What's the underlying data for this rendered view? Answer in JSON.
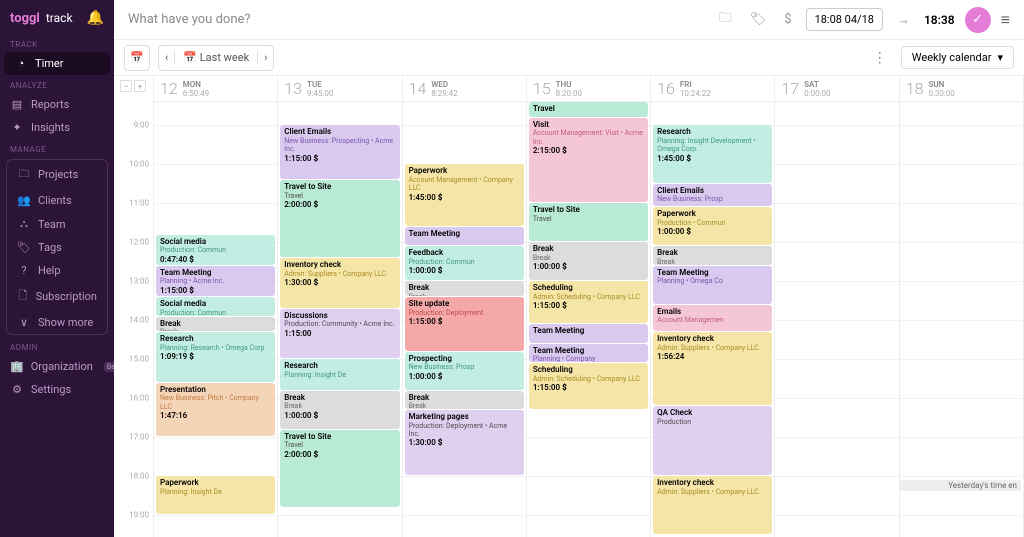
{
  "brand": {
    "name": "toggl",
    "sub": "track"
  },
  "sidebar": {
    "sections": [
      {
        "header": "TRACK",
        "items": [
          {
            "icon": "◔",
            "label": "Timer",
            "active": true
          }
        ]
      },
      {
        "header": "ANALYZE",
        "items": [
          {
            "icon": "▤",
            "label": "Reports"
          },
          {
            "icon": "✦",
            "label": "Insights"
          }
        ]
      },
      {
        "header": "MANAGE",
        "group": true,
        "items": [
          {
            "icon": "🗀",
            "label": "Projects"
          },
          {
            "icon": "👥",
            "label": "Clients"
          },
          {
            "icon": "⛬",
            "label": "Team"
          },
          {
            "icon": "🏷",
            "label": "Tags"
          },
          {
            "icon": "?",
            "label": "Help"
          },
          {
            "icon": "🗋",
            "label": "Subscription"
          },
          {
            "icon": "∨",
            "label": "Show more"
          }
        ]
      },
      {
        "header": "ADMIN",
        "items": [
          {
            "icon": "🏢",
            "label": "Organization",
            "beta": "Beta"
          },
          {
            "icon": "⚙",
            "label": "Settings"
          }
        ]
      }
    ]
  },
  "topbar": {
    "hint": "What have you done?",
    "timebox": "18:08  04/18",
    "arrow": "→",
    "time": "18:38"
  },
  "toolbar": {
    "lastweek": "Last week",
    "view": "Weekly calendar"
  },
  "hours": [
    "9:00",
    "10:00",
    "11:00",
    "12:00",
    "13:00",
    "14:00",
    "15:00",
    "16:00",
    "17:00",
    "18:00",
    "19:00"
  ],
  "sliceH": 39,
  "headerH": 26,
  "startHour": 8.4,
  "days": [
    {
      "num": "12",
      "wd": "MON",
      "total": "6:50:49"
    },
    {
      "num": "13",
      "wd": "TUE",
      "total": "9:45:00"
    },
    {
      "num": "14",
      "wd": "WED",
      "total": "8:29:42"
    },
    {
      "num": "15",
      "wd": "THU",
      "total": "8:20:00"
    },
    {
      "num": "16",
      "wd": "FRI",
      "total": "10:24:22"
    },
    {
      "num": "17",
      "wd": "SAT",
      "total": "0:00:00"
    },
    {
      "num": "18",
      "wd": "SUN",
      "total": "0:30:00"
    }
  ],
  "past_note": "Yesterday's time en",
  "colors": {
    "teal": "#c2ede2",
    "tealT": "#2a8a6e",
    "purple": "#d9c9ee",
    "purpleT": "#6b3fa0",
    "yellow": "#f5e6a8",
    "yellowT": "#9a7d0a",
    "pink": "#f5c6d6",
    "pinkT": "#b84a6e",
    "orange": "#f5d5b8",
    "orangeT": "#b86a2a",
    "gray": "#dcdcdc",
    "grayT": "#555",
    "red": "#f5a8a8",
    "redT": "#b83a3a",
    "mint": "#b8ead6",
    "blue": "#cfe0f0",
    "blueT": "#3a6ab8",
    "lav": "#e0d0f0"
  },
  "events": {
    "0": [
      {
        "s": 11.8,
        "e": 12.6,
        "c": "teal",
        "t": "Social media",
        "p": "Production: Commun",
        "d": "0:47:40",
        "bill": true
      },
      {
        "s": 12.6,
        "e": 13.4,
        "c": "purple",
        "t": "Team Meeting",
        "p": "Planning • Acme Inc.",
        "d": "1:15:00",
        "bill": true
      },
      {
        "s": 13.4,
        "e": 13.9,
        "c": "teal",
        "t": "Social media",
        "p": "Production: Commun"
      },
      {
        "s": 13.9,
        "e": 14.3,
        "c": "gray",
        "t": "Break",
        "p": "Break"
      },
      {
        "s": 14.3,
        "e": 15.6,
        "c": "teal",
        "t": "Research",
        "p": "Planning: Research • Omega Corp",
        "d": "1:09:19",
        "bill": true
      },
      {
        "s": 15.6,
        "e": 17.0,
        "c": "orange",
        "t": "Presentation",
        "p": "New Business: Pitch • Company LLC",
        "d": "1:47:16"
      },
      {
        "s": 18.0,
        "e": 19.0,
        "c": "yellow",
        "t": "Paperwork",
        "p": "Planning: Insight De"
      }
    ],
    "1": [
      {
        "s": 9.0,
        "e": 10.4,
        "c": "purple",
        "t": "Client Emails",
        "p": "New Business: Prospecting • Acme Inc.",
        "d": "1:15:00",
        "bill": true
      },
      {
        "s": 10.4,
        "e": 12.4,
        "c": "mint",
        "t": "Travel to Site",
        "p": "Travel",
        "d": "2:00:00",
        "bill": true
      },
      {
        "s": 12.4,
        "e": 13.7,
        "c": "yellow",
        "t": "Inventory check",
        "p": "Admin: Suppliers • Company LLC",
        "d": "1:30:00",
        "bill": true
      },
      {
        "s": 13.7,
        "e": 15.0,
        "c": "lav",
        "t": "Discussions",
        "p": "Production: Community • Acme Inc.",
        "d": "1:15:00"
      },
      {
        "s": 15.0,
        "e": 15.8,
        "c": "teal",
        "t": "Research",
        "p": "Planning: Insight De"
      },
      {
        "s": 15.8,
        "e": 16.8,
        "c": "gray",
        "t": "Break",
        "p": "Break",
        "d": "1:00:00",
        "bill": true
      },
      {
        "s": 16.8,
        "e": 18.8,
        "c": "mint",
        "t": "Travel to Site",
        "p": "Travel",
        "d": "2:00:00",
        "bill": true
      }
    ],
    "2": [
      {
        "s": 10.0,
        "e": 11.6,
        "c": "yellow",
        "t": "Paperwork",
        "p": "Account Management • Company LLC",
        "d": "1:45:00",
        "bill": true
      },
      {
        "s": 11.6,
        "e": 12.1,
        "c": "purple",
        "t": "Team Meeting"
      },
      {
        "s": 12.1,
        "e": 13.0,
        "c": "teal",
        "t": "Feedback",
        "p": "Production: Commun",
        "d": "1:00:00",
        "bill": true
      },
      {
        "s": 13.0,
        "e": 13.4,
        "c": "gray",
        "t": "Break",
        "p": "Break"
      },
      {
        "s": 13.4,
        "e": 14.8,
        "c": "red",
        "t": "Site update",
        "p": "Production: Deployment",
        "d": "1:15:00",
        "bill": true
      },
      {
        "s": 14.8,
        "e": 15.8,
        "c": "teal",
        "t": "Prospecting",
        "p": "New Business: Prosp",
        "d": "1:00:00",
        "bill": true
      },
      {
        "s": 15.8,
        "e": 16.3,
        "c": "gray",
        "t": "Break",
        "p": "Break"
      },
      {
        "s": 16.3,
        "e": 18.0,
        "c": "lav",
        "t": "Marketing pages",
        "p": "Production: Deployment • Acme Inc.",
        "d": "1:30:00",
        "bill": true
      }
    ],
    "3": [
      {
        "s": 8.4,
        "e": 8.8,
        "c": "mint",
        "t": "Travel"
      },
      {
        "s": 8.8,
        "e": 11.0,
        "c": "pink",
        "t": "Visit",
        "p": "Account Management: Visit • Acme Inc.",
        "d": "2:15:00",
        "bill": true
      },
      {
        "s": 11.0,
        "e": 12.0,
        "c": "mint",
        "t": "Travel to Site",
        "p": "Travel"
      },
      {
        "s": 12.0,
        "e": 13.0,
        "c": "gray",
        "t": "Break",
        "p": "Break",
        "d": "1:00:00",
        "bill": true
      },
      {
        "s": 13.0,
        "e": 14.1,
        "c": "yellow",
        "t": "Scheduling",
        "p": "Admin: Scheduling • Company LLC",
        "d": "1:15:00",
        "bill": true
      },
      {
        "s": 14.1,
        "e": 14.6,
        "c": "purple",
        "t": "Team Meeting"
      },
      {
        "s": 14.6,
        "e": 15.1,
        "c": "purple",
        "t": "Team Meeting",
        "p": "Planning • Company"
      },
      {
        "s": 15.1,
        "e": 16.3,
        "c": "yellow",
        "t": "Scheduling",
        "p": "Admin: Scheduling • Company LLC",
        "d": "1:15:00",
        "bill": true
      }
    ],
    "4": [
      {
        "s": 9.0,
        "e": 10.5,
        "c": "teal",
        "t": "Research",
        "p": "Planning: Insight Development • Omega Corp.",
        "d": "1:45:00",
        "bill": true
      },
      {
        "s": 10.5,
        "e": 11.1,
        "c": "purple",
        "t": "Client Emails",
        "p": "New Business: Prosp"
      },
      {
        "s": 11.1,
        "e": 12.1,
        "c": "yellow",
        "t": "Paperwork",
        "p": "Production • Commun",
        "d": "1:00:00",
        "bill": true
      },
      {
        "s": 12.1,
        "e": 12.6,
        "c": "gray",
        "t": "Break",
        "p": "Break"
      },
      {
        "s": 12.6,
        "e": 13.6,
        "c": "purple",
        "t": "Team Meeting",
        "p": "Planning • Omega Co"
      },
      {
        "s": 13.6,
        "e": 14.3,
        "c": "pink",
        "t": "Emails",
        "p": "Account Managemen"
      },
      {
        "s": 14.3,
        "e": 16.2,
        "c": "yellow",
        "t": "Inventory check",
        "p": "Admin: Suppliers • Company LLC",
        "d": "1:56:24"
      },
      {
        "s": 16.2,
        "e": 18.0,
        "c": "lav",
        "t": "QA Check",
        "p": "Production"
      },
      {
        "s": 18.0,
        "e": 19.5,
        "c": "yellow",
        "t": "Inventory check",
        "p": "Admin: Suppliers • Company LLC"
      }
    ],
    "5": [],
    "6": []
  }
}
